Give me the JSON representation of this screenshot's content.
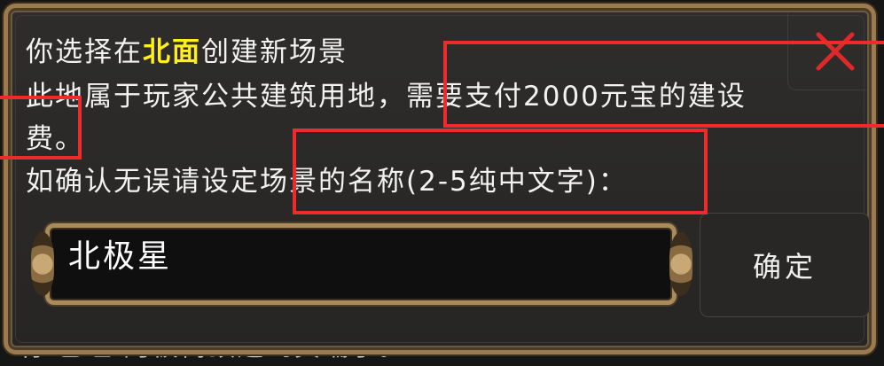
{
  "background_text": "有 已经 阿被树顶迅到员端了。",
  "dialog": {
    "message": {
      "line1_prefix": "你选择在",
      "line1_highlight": "北面",
      "line1_suffix": "创建新场景",
      "line2": "此地属于玩家公共建筑用地，需要支付2000元宝的建设",
      "line3": "费。",
      "line4": "如确认无误请设定场景的名称(2-5纯中文字)："
    },
    "name_input": {
      "value": "北极星"
    },
    "confirm_label": "确定",
    "close_icon": "close-icon"
  },
  "colors": {
    "highlight": "#ffef1f",
    "annotation": "#ee2a2a",
    "frame_gold": "#9a7a4e"
  }
}
